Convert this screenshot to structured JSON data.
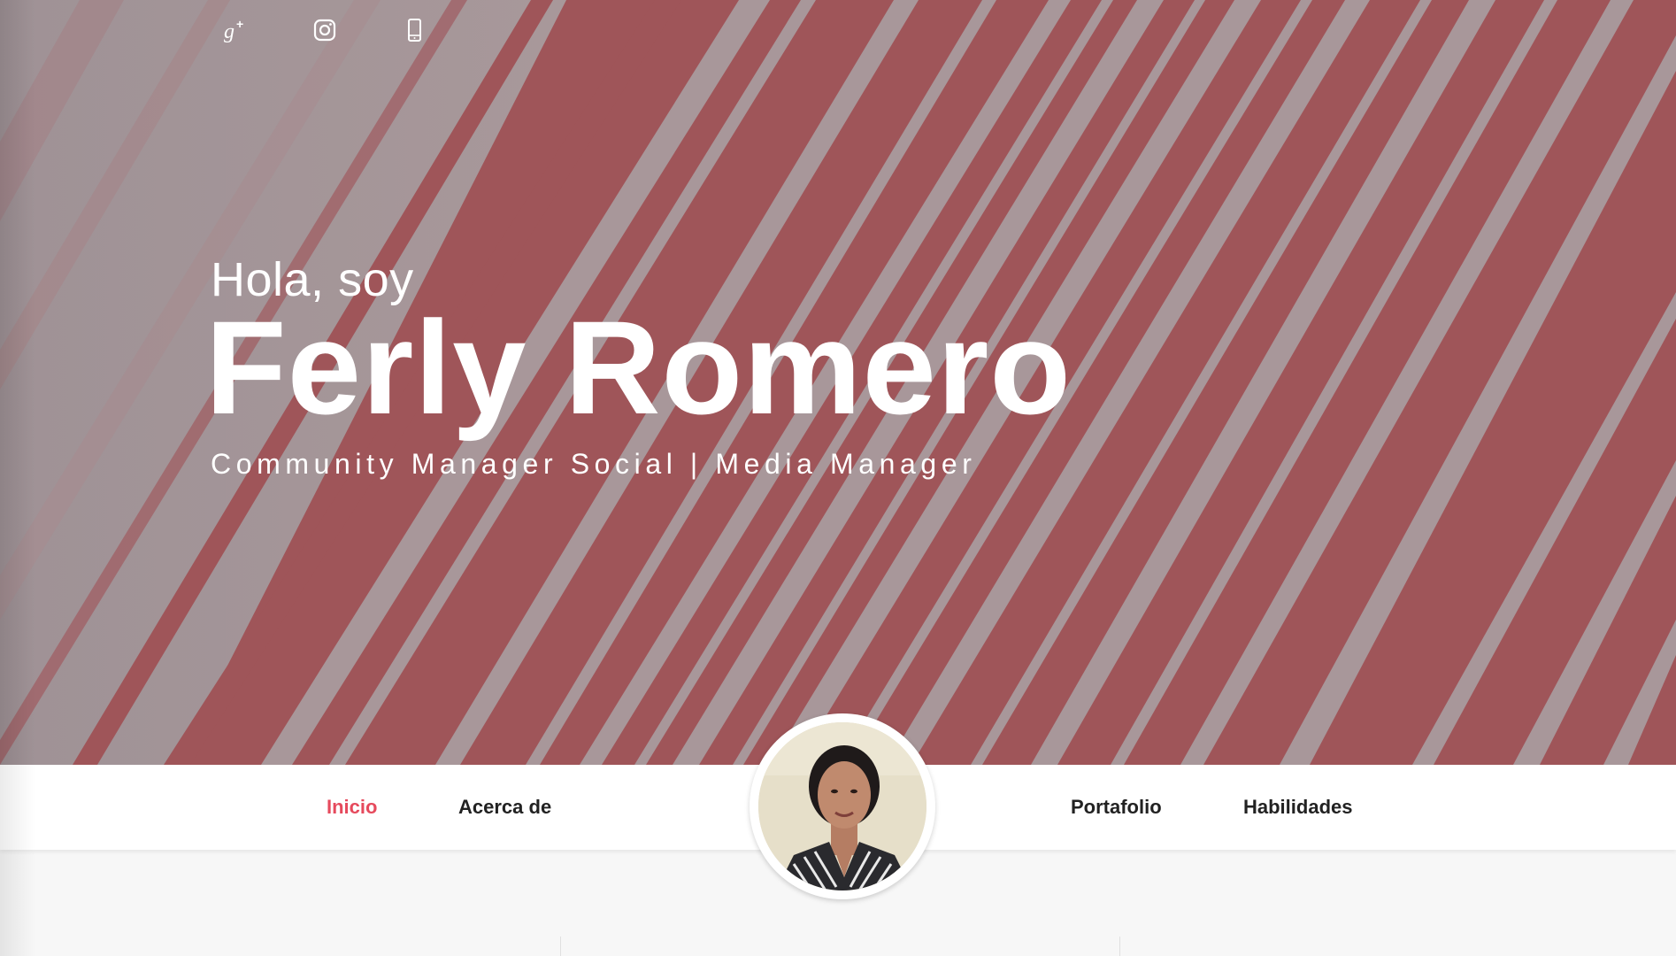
{
  "social": {
    "icons": [
      "google-plus-icon",
      "instagram-icon",
      "phone-icon"
    ]
  },
  "hero": {
    "greeting": "Hola, soy",
    "name": "Ferly Romero",
    "role": "Community Manager Social | Media Manager"
  },
  "nav": {
    "items": [
      {
        "label": "Inicio"
      },
      {
        "label": "Acerca de"
      },
      {
        "label": "Portafolio"
      },
      {
        "label": "Habilidades"
      }
    ]
  },
  "colors": {
    "accent": "#e64a5d",
    "hero_red": "#9f5559",
    "hero_gray": "#a59597",
    "nav_text": "#222222"
  }
}
